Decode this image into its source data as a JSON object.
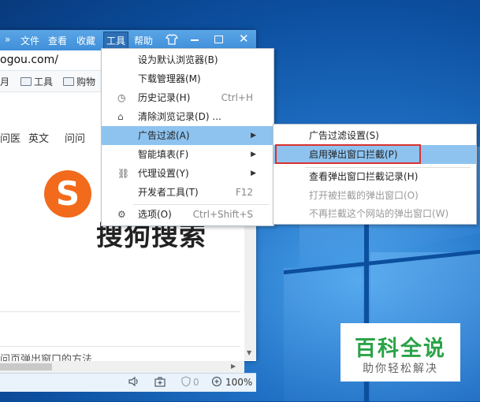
{
  "browser": {
    "menubar": {
      "chevron": "»",
      "file": "文件",
      "view": "查看",
      "favorites": "收藏",
      "tools": "工具",
      "help": "帮助"
    },
    "address": "ogou.com/",
    "bookmarks": {
      "partial": "月",
      "tools": "工具",
      "shopping": "购物"
    },
    "nav": {
      "medical": "问医",
      "english": "英文",
      "ask": "问问"
    },
    "logo": {
      "mark": "S",
      "text": "搜狗搜索"
    },
    "bottom_text": "问页弹出窗口的方法",
    "status": {
      "zoom": "100%",
      "shield_count": "0"
    }
  },
  "tools_menu": {
    "items": [
      {
        "label": "设为默认浏览器(B)",
        "shortcut": "",
        "icon": ""
      },
      {
        "label": "下载管理器(M)",
        "shortcut": "",
        "icon": ""
      },
      {
        "label": "历史记录(H)",
        "shortcut": "Ctrl+H",
        "icon": "clock-icon"
      },
      {
        "label": "清除浏览记录(D) ...",
        "shortcut": "",
        "icon": "eraser-icon"
      },
      {
        "label": "广告过滤(A)",
        "shortcut": "",
        "icon": "",
        "submenu": true
      },
      {
        "label": "智能填表(F)",
        "shortcut": "",
        "icon": "",
        "submenu": true
      },
      {
        "label": "代理设置(Y)",
        "shortcut": "",
        "icon": "link-icon",
        "submenu": true
      },
      {
        "label": "开发者工具(T)",
        "shortcut": "F12",
        "icon": ""
      },
      {
        "label": "选项(O)",
        "shortcut": "Ctrl+Shift+S",
        "icon": "gear-icon"
      }
    ]
  },
  "adfilter_submenu": {
    "items": [
      {
        "label": "广告过滤设置(S)"
      },
      {
        "label": "启用弹出窗口拦截(P)"
      },
      {
        "label": "查看弹出窗口拦截记录(H)"
      },
      {
        "label": "打开被拦截的弹出窗口(O)"
      },
      {
        "label": "不再拦截这个网站的弹出窗口(W)"
      }
    ]
  },
  "watermark": {
    "title": "百科全说",
    "subtitle": "助你轻松解决"
  },
  "colors": {
    "highlight": "#8ec3ef",
    "red_box": "#d9322f",
    "title_bar": "#3f8fd9",
    "logo_orange": "#f26a1b",
    "watermark_green": "#2aa348"
  }
}
